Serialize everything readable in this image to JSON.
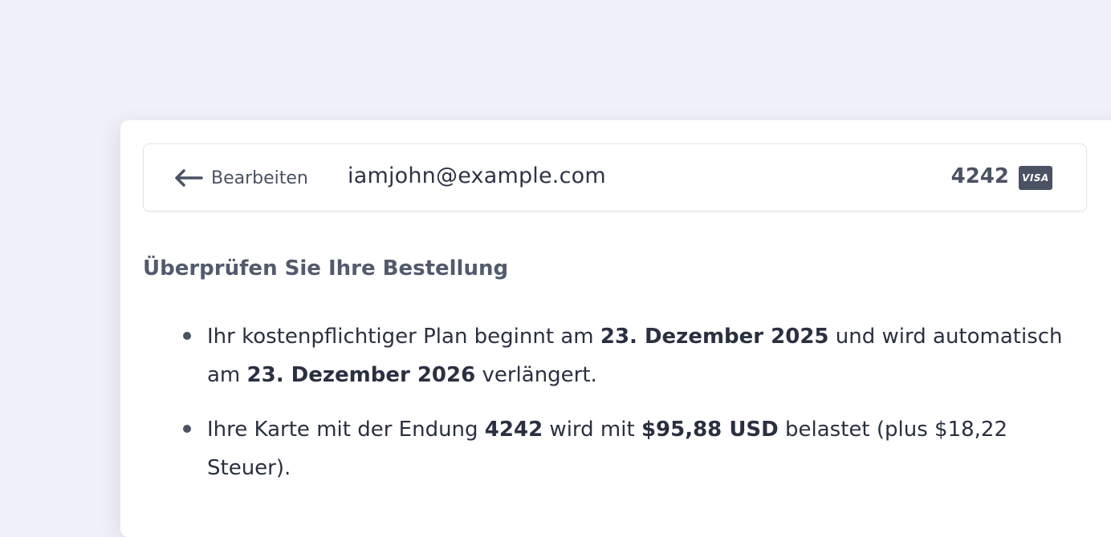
{
  "summary": {
    "edit_label": "Bearbeiten",
    "email": "iamjohn@example.com",
    "card_last4": "4242",
    "card_brand": "VISA"
  },
  "review": {
    "heading": "Überprüfen Sie Ihre Bestellung",
    "item1": {
      "t1": "Ihr kostenpflichtiger Plan beginnt am ",
      "b1": "23. Dezember 2025",
      "t2": " und wird automatisch am ",
      "b2": "23. Dezember 2026",
      "t3": " verlängert."
    },
    "item2": {
      "t1": "Ihre Karte mit der Endung ",
      "b1": "4242",
      "t2": " wird mit ",
      "b2": "$95,88 USD",
      "t3": " belastet (plus $18,22 Steuer)."
    }
  },
  "colors": {
    "page_background": "#f0f0f8",
    "card_background": "#ffffff",
    "text": "#2a3040",
    "muted_text": "#4b5263"
  }
}
